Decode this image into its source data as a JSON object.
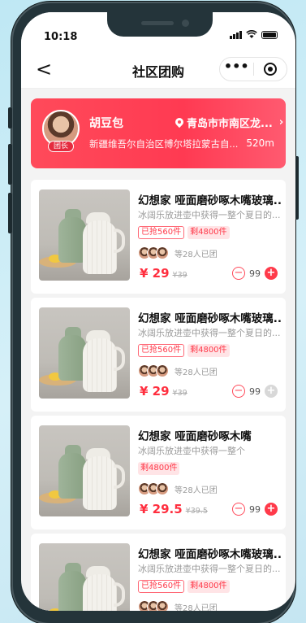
{
  "status": {
    "time": "10:18"
  },
  "nav": {
    "back_label": "<",
    "title": "社区团购",
    "more_label": "•••"
  },
  "leader": {
    "name": "胡豆包",
    "badge": "团长",
    "location": "青岛市市南区龙...",
    "address": "新疆维吾尔自治区博尔塔拉蒙古自...",
    "distance": "520m"
  },
  "products": [
    {
      "title": "幻想家 哑面磨砂啄木嘴玻璃...",
      "subtitle": "冰阔乐放进壶中获得一整个夏日的...",
      "sold": "已抢560件",
      "remaining": "剩4800件",
      "group_text": "等28人已团",
      "price": "¥ 29",
      "original_price": "¥39",
      "quantity": "99",
      "plus_enabled": true
    },
    {
      "title": "幻想家 哑面磨砂啄木嘴玻璃...",
      "subtitle": "冰阔乐放进壶中获得一整个夏日的...",
      "sold": "已抢560件",
      "remaining": "剩4800件",
      "group_text": "等28人已团",
      "price": "¥ 29",
      "original_price": "¥39",
      "quantity": "99",
      "plus_enabled": false
    },
    {
      "title": "幻想家 哑面磨砂啄木嘴",
      "subtitle": "冰阔乐放进壶中获得一整个",
      "sold": "",
      "remaining": "剩4800件",
      "group_text": "等28人已团",
      "price": "¥ 29.5",
      "original_price": "¥39.5",
      "quantity": "99",
      "plus_enabled": true
    },
    {
      "title": "幻想家 哑面磨砂啄木嘴玻璃...",
      "subtitle": "冰阔乐放进壶中获得一整个夏日的...",
      "sold": "已抢560件",
      "remaining": "剩4800件",
      "group_text": "等28人已团",
      "price": "",
      "original_price": "",
      "quantity": "",
      "plus_enabled": true
    }
  ]
}
